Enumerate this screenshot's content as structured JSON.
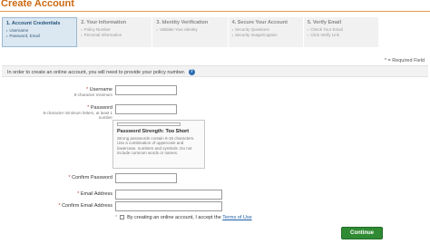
{
  "page": {
    "title": "Create Account"
  },
  "steps": [
    {
      "title": "1. Account Credentials",
      "sub": [
        "Username",
        "Password, Email"
      ]
    },
    {
      "title": "2. Your Information",
      "sub": [
        "Policy Number",
        "Personal Information"
      ]
    },
    {
      "title": "3. Identity Verification",
      "sub": [
        "Validate Your Identity",
        ""
      ]
    },
    {
      "title": "4. Secure Your Account",
      "sub": [
        "Security Questions",
        "Security Image/Caption"
      ]
    },
    {
      "title": "5. Verify Email",
      "sub": [
        "Check Your Email",
        "Click Verify Link"
      ]
    }
  ],
  "required_note": "* = Required Field",
  "info": {
    "text": "In order to create an online account, you will need to provide your policy number."
  },
  "form": {
    "username": {
      "label": "Username",
      "hint": "8-character minimum",
      "value": ""
    },
    "password": {
      "label": "Password",
      "hint": "8-character minimum letters, at least 1 number",
      "value": ""
    },
    "password_strength": {
      "label": "Password Strength:",
      "value": "Too Short",
      "description": "Strong passwords contain 8-16 characters. Use a combination of uppercase and lowercase, numbers and symbols. Do not include common words or names."
    },
    "confirm_password": {
      "label": "Confirm Password",
      "value": ""
    },
    "email": {
      "label": "Email Address",
      "value": ""
    },
    "confirm_email": {
      "label": "Confirm Email Address",
      "value": ""
    },
    "terms": {
      "prefix": "By creating an online account, I accept the",
      "link": "Terms of Use"
    }
  },
  "actions": {
    "continue": "Continue"
  }
}
